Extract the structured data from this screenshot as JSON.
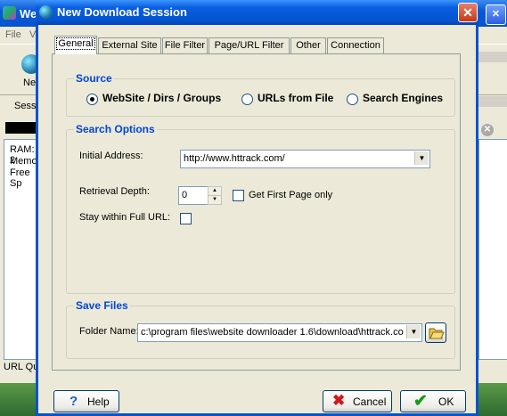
{
  "background_app": {
    "title": "We",
    "menu": {
      "file": "File",
      "view": "V"
    },
    "toolbar_new": "Ne",
    "session_label": "Sess",
    "stats_lines": [
      "RAM: 2",
      "Memor",
      "Free Sp"
    ],
    "status_prefix": "URL Qu"
  },
  "dialog": {
    "title": "New Download Session",
    "tabs": [
      "General",
      "External Site",
      "File Filter",
      "Page/URL Filter",
      "Other",
      "Connection"
    ],
    "active_tab": "General",
    "source": {
      "title": "Source",
      "options": [
        "WebSite / Dirs / Groups",
        "URLs from File",
        "Search Engines"
      ],
      "selected": "WebSite / Dirs / Groups"
    },
    "search_options": {
      "title": "Search Options",
      "initial_address_label": "Initial Address:",
      "initial_address_value": "http://www.httrack.com/",
      "retrieval_depth_label": "Retrieval Depth:",
      "retrieval_depth_value": "0",
      "get_first_page_label": "Get First Page only",
      "get_first_page_checked": false,
      "stay_within_label": "Stay within Full URL:",
      "stay_within_checked": false
    },
    "save_files": {
      "title": "Save Files",
      "folder_label": "Folder Name:",
      "folder_value": "c:\\program files\\website downloader 1.6\\download\\httrack.co"
    },
    "buttons": {
      "help": "Help",
      "cancel": "Cancel",
      "ok": "OK"
    }
  },
  "colors": {
    "group_title": "#0046d5",
    "titlebar": "#0554d0",
    "panel": "#ece9d8"
  }
}
